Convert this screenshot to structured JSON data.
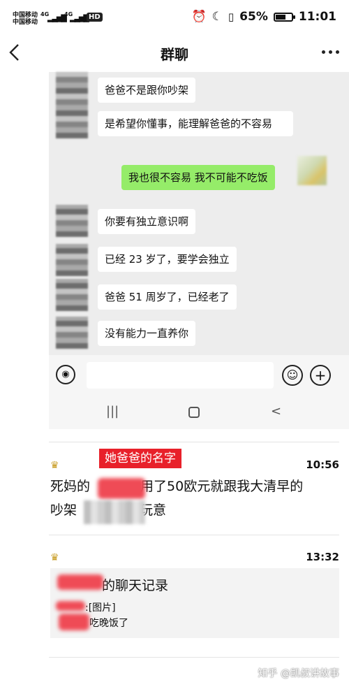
{
  "status_bar": {
    "carrier_1": "中国移动",
    "carrier_2": "中国移动",
    "network_1": "4G",
    "network_2": "4G",
    "hd": "HD",
    "battery": "65%",
    "battery_level": 0.65,
    "time": "11:01"
  },
  "header": {
    "title": "群聊"
  },
  "chat": {
    "messages": [
      {
        "side": "left",
        "text": "爸爸不是跟你吵架"
      },
      {
        "side": "left",
        "text": "是希望你懂事，能理解爸爸的不容易"
      },
      {
        "side": "right",
        "text": "我也很不容易 我不可能不吃饭"
      },
      {
        "side": "left",
        "text": "你要有独立意识啊"
      },
      {
        "side": "left",
        "text": "已经 23 岁了，要学会独立"
      },
      {
        "side": "left",
        "text": "爸爸 51 周岁了，已经老了"
      },
      {
        "side": "left",
        "text": "没有能力一直养你"
      }
    ]
  },
  "nav": {
    "recents": "|||",
    "back": "<"
  },
  "post1": {
    "tag": "她爸爸的名字",
    "time": "10:56",
    "line1_a": "死妈的",
    "line1_b": "用了50欧元就跟我大清早的",
    "line2_a": "吵架",
    "line2_b": "玩意"
  },
  "post2": {
    "time": "13:32",
    "title": "的聊天记录",
    "line1": ":[图片]",
    "line2": "吃晚饭了"
  },
  "watermark": "知乎 @凯叔讲故事",
  "colors": {
    "bubble_self": "#95ec69",
    "chat_bg": "#ededed",
    "tag_red": "#e8202a"
  }
}
